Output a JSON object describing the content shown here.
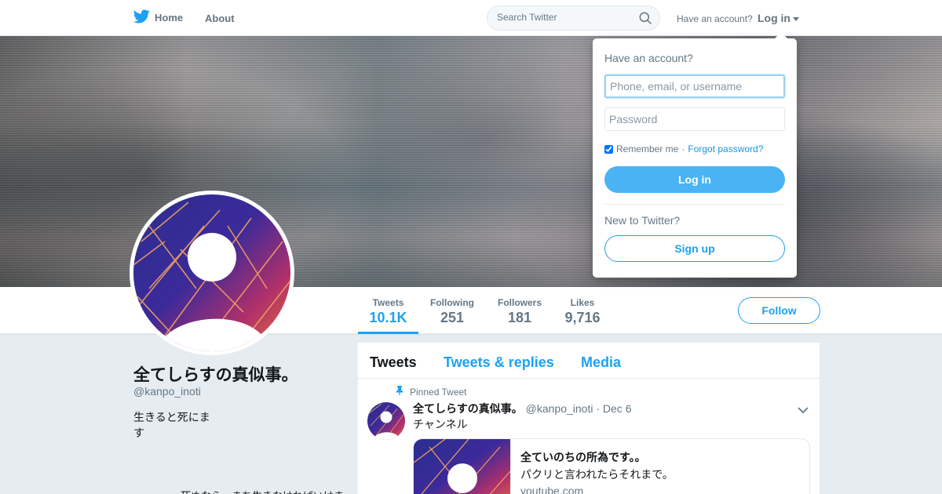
{
  "nav": {
    "home_label": "Home",
    "about_label": "About",
    "search_placeholder": "Search Twitter",
    "have_account": "Have an account?",
    "login_label": "Log in"
  },
  "profile": {
    "name": "全てしらすの真似事。",
    "handle": "@kanpo_inoti",
    "bio": "生きると死にます",
    "bio_continued": "死ぬなら、まち生きなければいけま",
    "follow_label": "Follow"
  },
  "stats": [
    {
      "label": "Tweets",
      "value": "10.1K",
      "active": true
    },
    {
      "label": "Following",
      "value": "251",
      "active": false
    },
    {
      "label": "Followers",
      "value": "181",
      "active": false
    },
    {
      "label": "Likes",
      "value": "9,716",
      "active": false
    }
  ],
  "timeline": {
    "tabs": [
      {
        "label": "Tweets",
        "active": true
      },
      {
        "label": "Tweets & replies",
        "active": false
      },
      {
        "label": "Media",
        "active": false
      }
    ],
    "pinned_label": "Pinned Tweet",
    "tweet": {
      "name": "全てしらすの真似事。",
      "handle": "@kanpo_inoti",
      "separator": "·",
      "date": "Dec 6",
      "text": "チャンネル",
      "card": {
        "title": "全ていのちの所為です。。",
        "description": "パクリと言われたらそれまで。",
        "domain": "youtube.com"
      }
    }
  },
  "login_dropdown": {
    "heading": "Have an account?",
    "username_placeholder": "Phone, email, or username",
    "password_placeholder": "Password",
    "remember_label": "Remember me",
    "separator": "·",
    "forgot_label": "Forgot password?",
    "login_button": "Log in",
    "new_label": "New to Twitter?",
    "signup_button": "Sign up"
  },
  "colors": {
    "accent": "#1da1f2",
    "login_button_bg": "#4ab3f4",
    "page_bg": "#e6ecf0",
    "muted_text": "#657786"
  },
  "icons": {
    "logo": "twitter-bird-icon",
    "search": "search-icon",
    "pin": "pin-icon",
    "chevron": "chevron-down-icon"
  }
}
